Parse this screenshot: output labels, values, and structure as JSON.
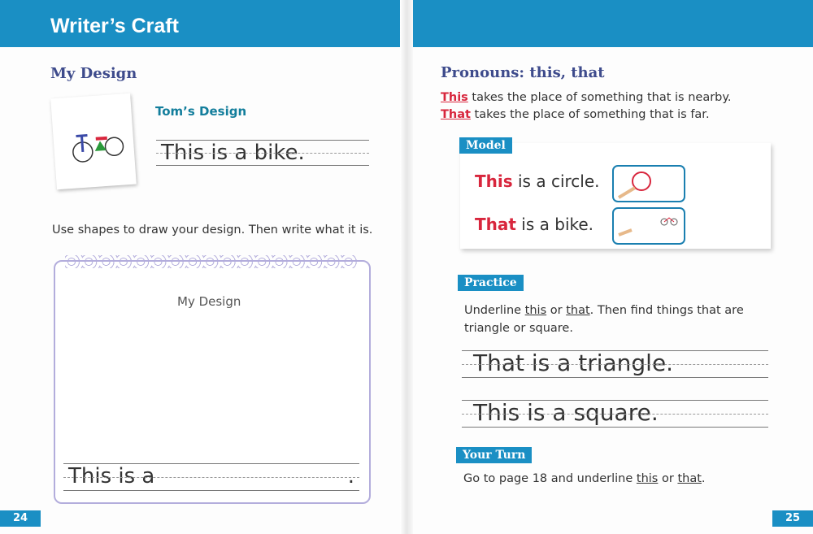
{
  "left": {
    "header": "Writer’s Craft",
    "heading": "My Design",
    "example_label": "Tom’s Design",
    "example_sentence": "This is a bike.",
    "instruction": "Use shapes to draw your design. Then write what it is.",
    "notebook_title": "My Design",
    "notebook_prompt": "This is a",
    "notebook_end": ".",
    "page_number": "24"
  },
  "right": {
    "heading": "Pronouns: this, that",
    "rule1_word": "This",
    "rule1_rest": " takes the place of something that is nearby.",
    "rule2_word": "That",
    "rule2_rest": " takes the place of something that is far.",
    "model_label": "Model",
    "model1_word": "This",
    "model1_rest": " is a circle.",
    "model2_word": "That",
    "model2_rest": " is a bike.",
    "practice_label": "Practice",
    "practice_a": "Underline ",
    "practice_this": "this",
    "practice_or": " or ",
    "practice_that": "that",
    "practice_b": ". Then find things that are triangle or square.",
    "practice1": "That is a triangle.",
    "practice2": "This is a square.",
    "your_turn_label": "Your Turn",
    "yt_a": "Go to page 18 and underline ",
    "yt_this": "this",
    "yt_or": " or ",
    "yt_that": "that",
    "yt_b": ".",
    "page_number": "25"
  },
  "colors": {
    "brand_blue": "#1a8fc4",
    "heading": "#3e4b8c",
    "red": "#d8263d"
  }
}
